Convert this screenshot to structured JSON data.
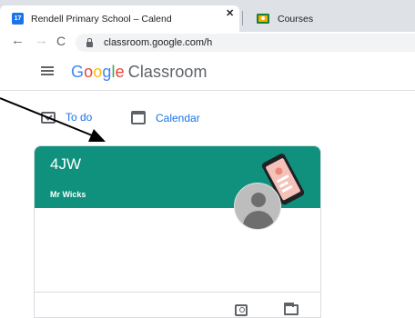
{
  "browser": {
    "tabs": [
      {
        "favicon": "calendar-17-icon",
        "label": "Rendell Primary School – Calend",
        "active": true
      },
      {
        "favicon": "classroom-icon",
        "label": "Courses",
        "active": false
      }
    ],
    "calendar_favicon_text": "17",
    "close_glyph": "✕",
    "url": "classroom.google.com/h",
    "nav_icons": {
      "back": "←",
      "forward": "→",
      "reload": "C"
    }
  },
  "header": {
    "brand_letters": [
      "G",
      "o",
      "o",
      "g",
      "l",
      "e"
    ],
    "product": "Classroom"
  },
  "nav": {
    "todo_label": "To do",
    "calendar_label": "Calendar"
  },
  "class_card": {
    "title": "4JW",
    "teacher": "Mr Wicks",
    "banner_color": "#10917e"
  },
  "colors": {
    "link": "#1a73e8",
    "google_blue": "#4285f4",
    "google_red": "#ea4335",
    "google_yellow": "#fbbc05",
    "google_green": "#34a853"
  }
}
